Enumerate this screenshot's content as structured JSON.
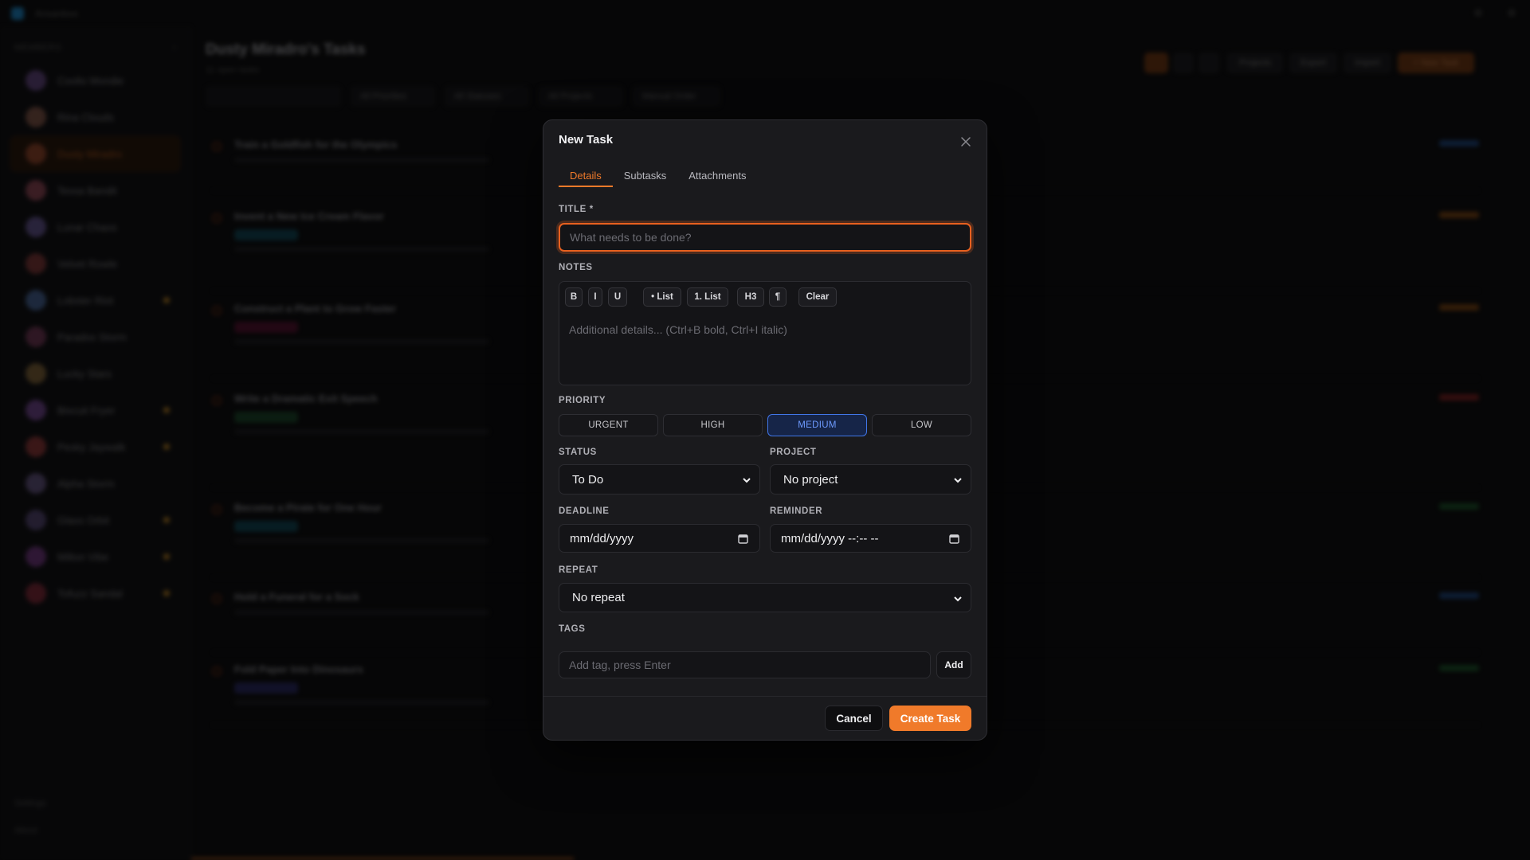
{
  "app": {
    "name": "Ansanboo",
    "board_title": "Dusty Miradro's Tasks",
    "board_subtitle": "11 open tasks",
    "sidebar_heading": "MEMBERS",
    "sidebar_footer": [
      "Settings",
      "About"
    ],
    "toolbar": [
      "Projects",
      "Export",
      "Import",
      "+ New Task"
    ],
    "filters": [
      "All Priorities",
      "All Statuses",
      "All Projects",
      "Manual Order"
    ],
    "members": [
      {
        "name": "Coolio Mondie",
        "color": "#6a4a8a",
        "dot": false,
        "active": false
      },
      {
        "name": "Rina Clouds",
        "color": "#8a5a4a",
        "dot": false,
        "active": false
      },
      {
        "name": "Dusty Miradro",
        "color": "#a04a2a",
        "dot": false,
        "active": true
      },
      {
        "name": "Tessa Bandit",
        "color": "#9a4a5a",
        "dot": false,
        "active": false
      },
      {
        "name": "Lunar Chaos",
        "color": "#6a5a9a",
        "dot": false,
        "active": false
      },
      {
        "name": "Velvet Rowle",
        "color": "#8a3a3a",
        "dot": false,
        "active": false
      },
      {
        "name": "Lobster Riot",
        "color": "#4a6aa0",
        "dot": true,
        "active": false
      },
      {
        "name": "Paradox Storm",
        "color": "#7a3a5a",
        "dot": false,
        "active": false
      },
      {
        "name": "Lucky Stars",
        "color": "#8a6a3a",
        "dot": false,
        "active": false
      },
      {
        "name": "Biscuit Fryer",
        "color": "#7a4a9a",
        "dot": true,
        "active": false
      },
      {
        "name": "Pesky Jaywalk",
        "color": "#9a3a3a",
        "dot": true,
        "active": false
      },
      {
        "name": "Alpha Storm",
        "color": "#6a5a8a",
        "dot": false,
        "active": false
      },
      {
        "name": "Glass Orbit",
        "color": "#5a4a7a",
        "dot": true,
        "active": false
      },
      {
        "name": "Milton Vibe",
        "color": "#7a3a8a",
        "dot": true,
        "active": false
      },
      {
        "name": "Tofuzz Sandal",
        "color": "#8a2a3a",
        "dot": true,
        "active": false
      }
    ],
    "tasks": [
      {
        "title": "Train a Goldfish for the Olympics",
        "tag_color": "#1e4a8a",
        "chip": ""
      },
      {
        "title": "Invent a New Ice Cream Flavor",
        "tag_color": "#8a4a10",
        "chip": "#0e4a5a"
      },
      {
        "title": "Construct a Plant to Grow Faster",
        "tag_color": "#8a4a10",
        "chip": "#5a1030"
      },
      {
        "title": "Write a Dramatic Exit Speech",
        "tag_color": "#8a2020",
        "chip": "#1a4a2a"
      },
      {
        "title": "Become a Pirate for One Hour",
        "tag_color": "#1a5a2a",
        "chip": "#0e4a5a"
      },
      {
        "title": "Hold a Funeral for a Sock",
        "tag_color": "#1e4a8a",
        "chip": ""
      },
      {
        "title": "Fold Paper Into Dinosaurs",
        "tag_color": "#1a5a2a",
        "chip": "#2a2a6a"
      }
    ]
  },
  "modal": {
    "title": "New Task",
    "tabs": [
      "Details",
      "Subtasks",
      "Attachments"
    ],
    "title_label": "TITLE *",
    "title_placeholder": "What needs to be done?",
    "notes_label": "NOTES",
    "format_buttons": [
      "B",
      "I",
      "U",
      "• List",
      "1. List",
      "H3",
      "¶",
      "Clear"
    ],
    "notes_placeholder": "Additional details... (Ctrl+B bold, Ctrl+I italic)",
    "priority_label": "PRIORITY",
    "priorities": [
      "URGENT",
      "HIGH",
      "MEDIUM",
      "LOW"
    ],
    "priority_selected": "MEDIUM",
    "status_label": "STATUS",
    "status_value": "To Do",
    "project_label": "PROJECT",
    "project_value": "No project",
    "deadline_label": "DEADLINE",
    "deadline_value": "mm/dd/yyyy",
    "reminder_label": "REMINDER",
    "reminder_value": "mm/dd/yyyy --:-- --",
    "repeat_label": "REPEAT",
    "repeat_value": "No repeat",
    "tags_label": "TAGS",
    "tags_placeholder": "Add tag, press Enter",
    "add_label": "Add",
    "cancel_label": "Cancel",
    "create_label": "Create Task"
  },
  "colors": {
    "accent": "#f07a2a",
    "selected_priority": "#4176e8"
  }
}
